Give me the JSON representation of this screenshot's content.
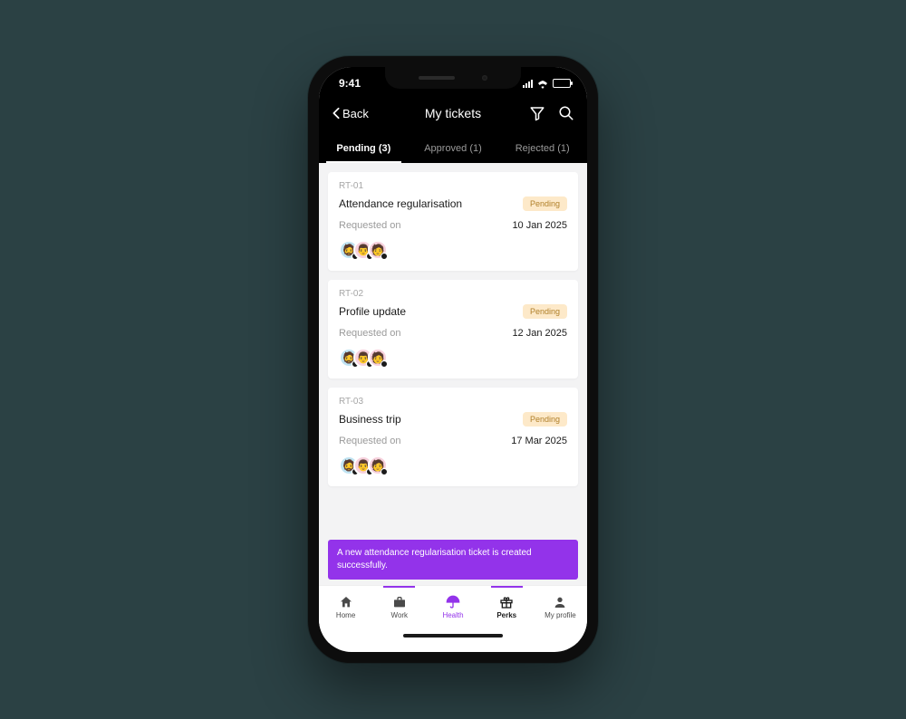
{
  "status": {
    "time": "9:41"
  },
  "header": {
    "back_label": "Back",
    "title": "My tickets"
  },
  "tabs": [
    {
      "label": "Pending (3)",
      "active": true
    },
    {
      "label": "Approved (1)",
      "active": false
    },
    {
      "label": "Rejected (1)",
      "active": false
    }
  ],
  "tickets": [
    {
      "id": "RT-01",
      "title": "Attendance regularisation",
      "status": "Pending",
      "requested_label": "Requested on",
      "date": "10 Jan 2025"
    },
    {
      "id": "RT-02",
      "title": "Profile update",
      "status": "Pending",
      "requested_label": "Requested on",
      "date": "12 Jan 2025"
    },
    {
      "id": "RT-03",
      "title": "Business trip",
      "status": "Pending",
      "requested_label": "Requested on",
      "date": "17 Mar 2025"
    }
  ],
  "toast": "A new attendance regularisation ticket is created successfully.",
  "nav": {
    "items": [
      {
        "label": "Home"
      },
      {
        "label": "Work"
      },
      {
        "label": "Health"
      },
      {
        "label": "Perks"
      },
      {
        "label": "My profile"
      }
    ]
  },
  "colors": {
    "accent": "#9333ea",
    "pending_bg": "#fde9c9",
    "pending_fg": "#b0802a"
  }
}
